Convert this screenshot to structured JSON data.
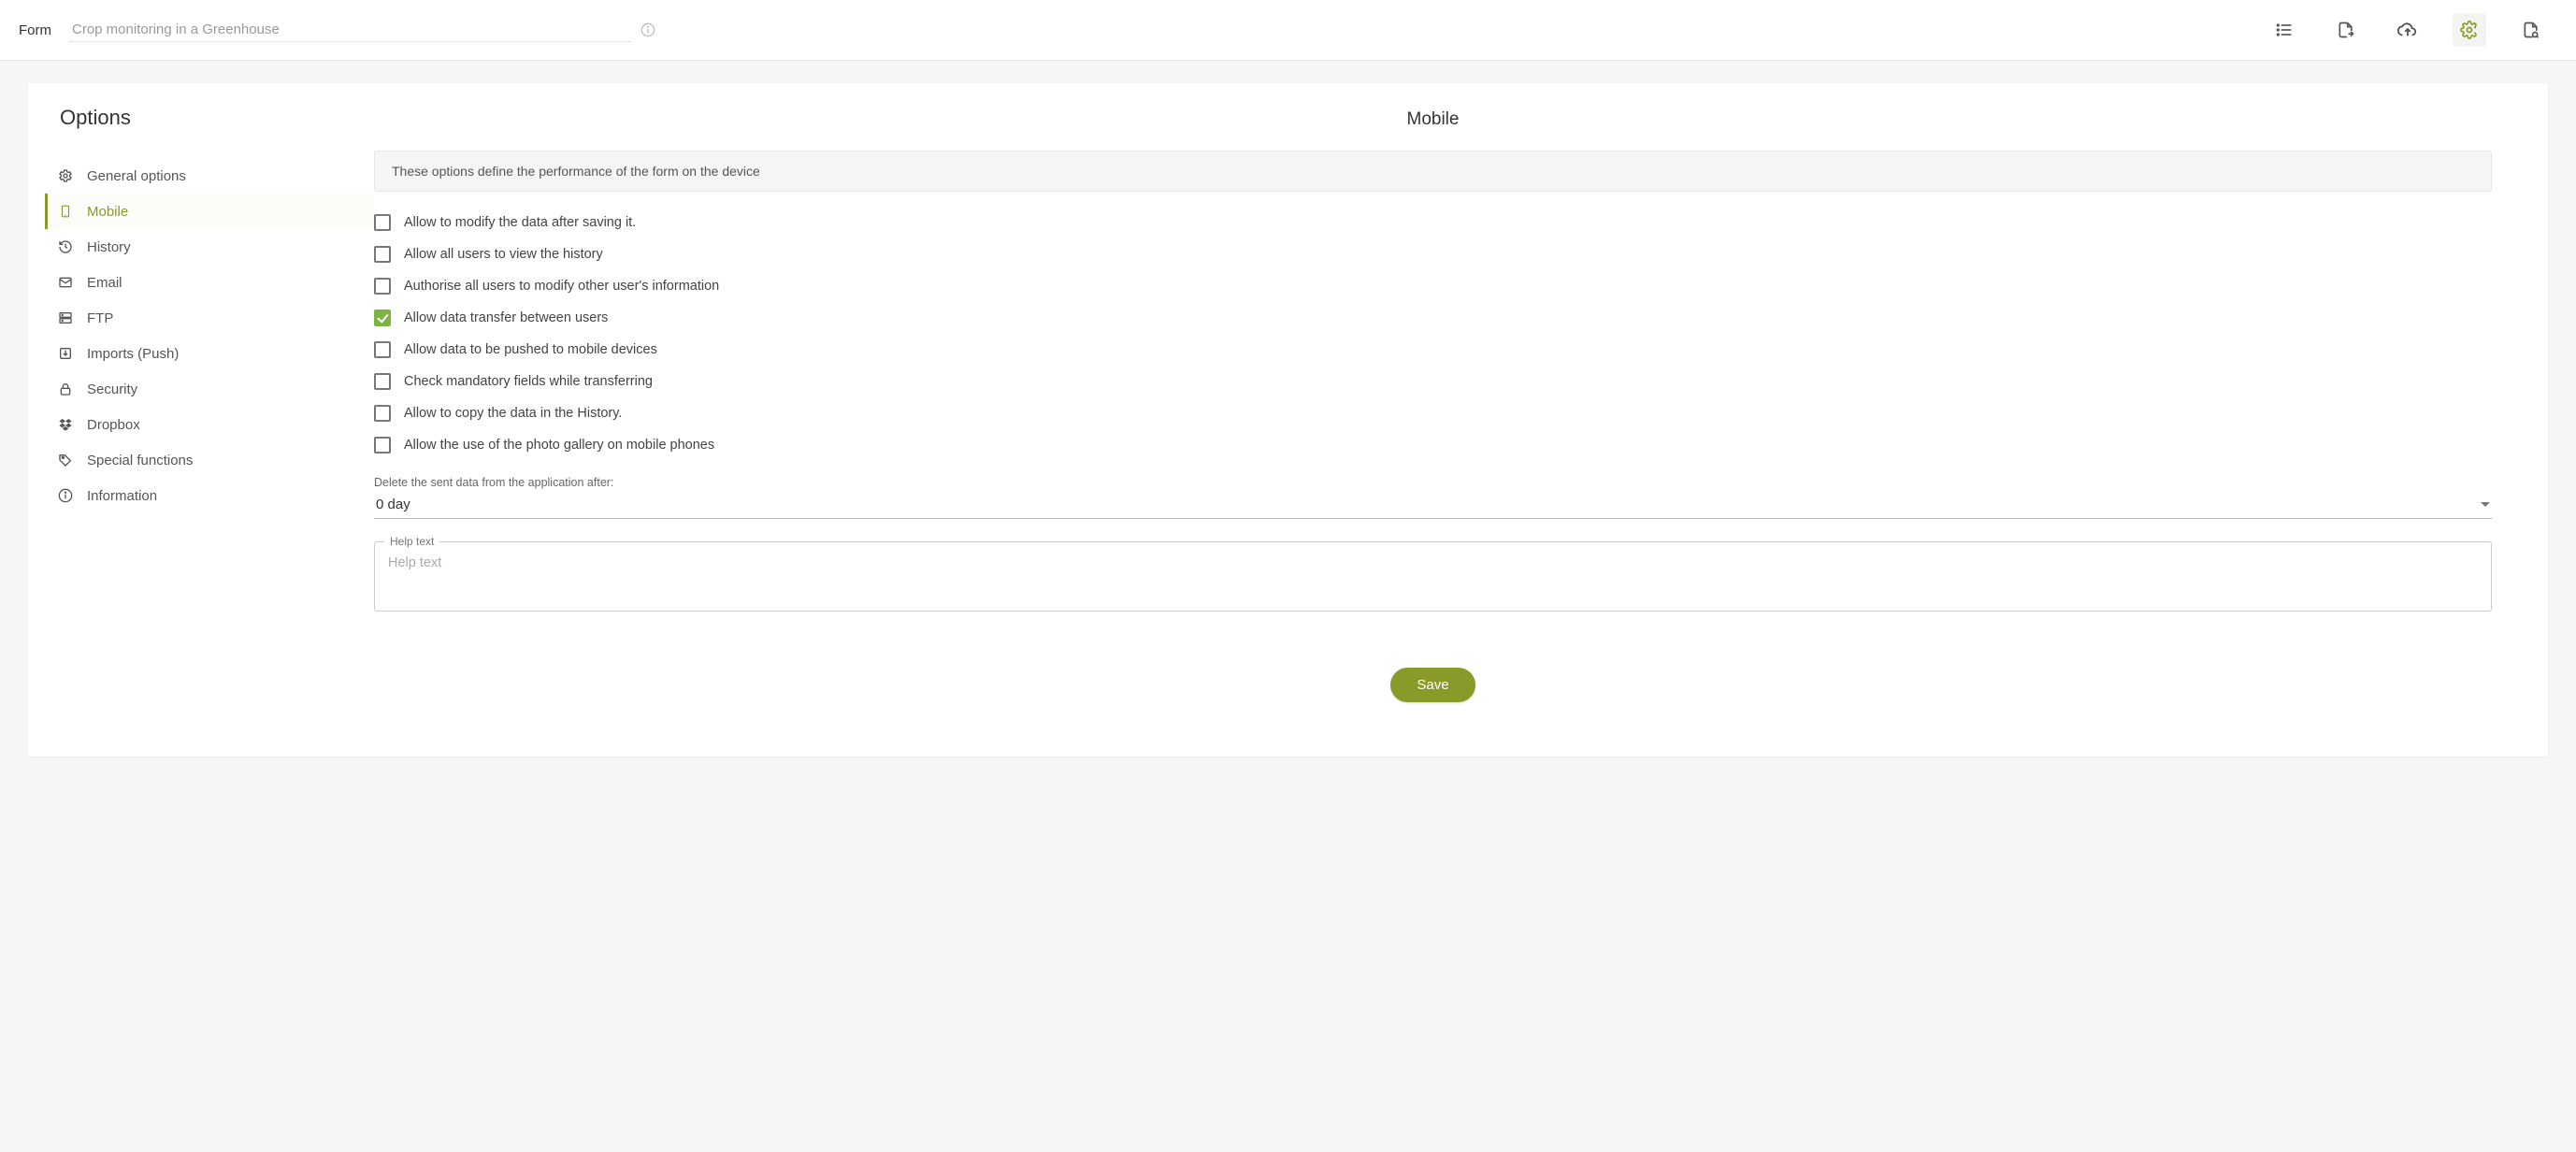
{
  "topbar": {
    "form_label": "Form",
    "form_name": "Crop monitoring in a Greenhouse"
  },
  "sidebar": {
    "title": "Options",
    "items": [
      {
        "label": "General options"
      },
      {
        "label": "Mobile"
      },
      {
        "label": "History"
      },
      {
        "label": "Email"
      },
      {
        "label": "FTP"
      },
      {
        "label": "Imports (Push)"
      },
      {
        "label": "Security"
      },
      {
        "label": "Dropbox"
      },
      {
        "label": "Special functions"
      },
      {
        "label": "Information"
      }
    ]
  },
  "content": {
    "heading": "Mobile",
    "banner": "These options define the performance of the form on the device",
    "checks": [
      {
        "label": "Allow to modify the data after saving it.",
        "checked": false
      },
      {
        "label": "Allow all users to view the history",
        "checked": false
      },
      {
        "label": "Authorise all users to modify other user's information",
        "checked": false
      },
      {
        "label": "Allow data transfer between users",
        "checked": true
      },
      {
        "label": "Allow data to be pushed to mobile devices",
        "checked": false
      },
      {
        "label": "Check mandatory fields while transferring",
        "checked": false
      },
      {
        "label": "Allow to copy the data in the History.",
        "checked": false
      },
      {
        "label": "Allow the use of the photo gallery on mobile phones",
        "checked": false
      }
    ],
    "delete_label": "Delete the sent data from the application after:",
    "delete_value": "0 day",
    "help_label": "Help text",
    "help_placeholder": "Help text",
    "save_label": "Save"
  }
}
